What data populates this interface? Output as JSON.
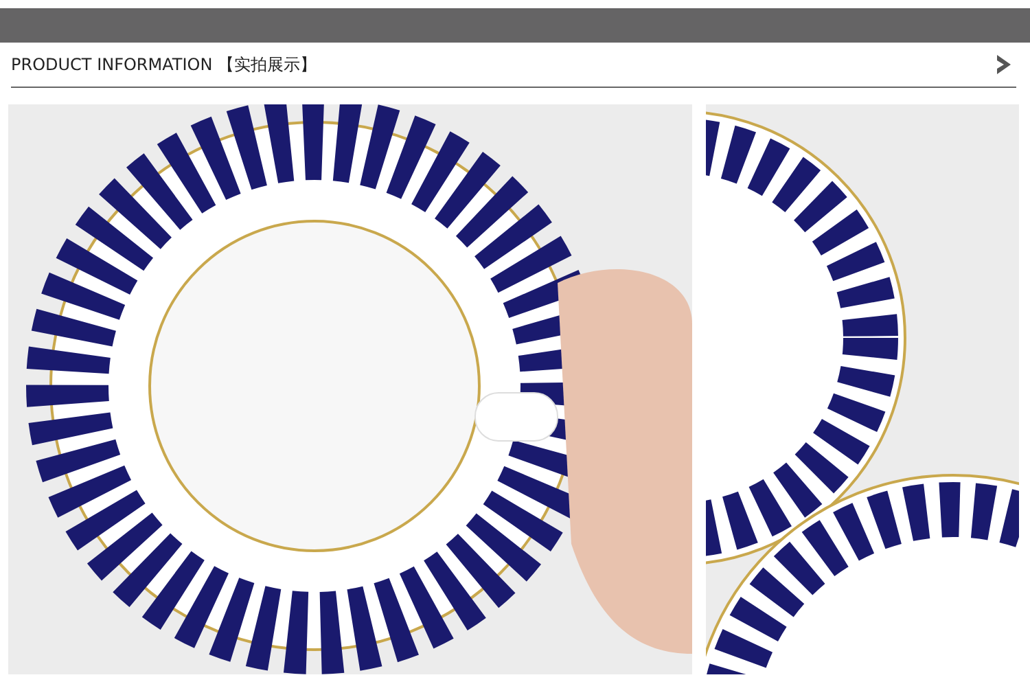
{
  "header": {
    "title": "PRODUCT INFORMATION",
    "subtitle": "【实拍展示】"
  },
  "photos": [
    {
      "kind": "cup"
    },
    {
      "kind": "plate"
    }
  ]
}
